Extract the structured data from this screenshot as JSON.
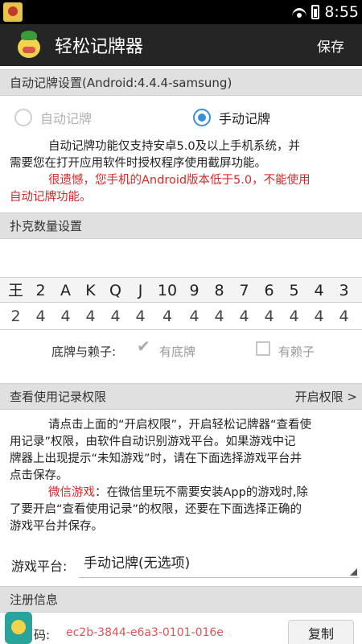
{
  "status_bar": {
    "time": "8:55"
  },
  "action_bar": {
    "title": "轻松记牌器",
    "save_label": "保存"
  },
  "auto_section": {
    "header": "自动记牌设置(Android:4.4.4-samsung)",
    "radio_auto": "自动记牌",
    "radio_manual": "手动记牌",
    "selected": "手动记牌",
    "info_line1": "自动记牌功能仅支持安卓5.0及以上手机系统，并",
    "info_line2": "需要您在打开应用软件时授权程序使用截屏功能。",
    "warning_line1": "很遗憾，您手机的Android版本低于5.0，不能使用",
    "warning_line2": "自动记牌功能。"
  },
  "poker_section": {
    "header": "扑克数量设置",
    "cards": [
      "王",
      "2",
      "A",
      "K",
      "Q",
      "J",
      "10",
      "9",
      "8",
      "7",
      "6",
      "5",
      "4",
      "3"
    ],
    "counts": [
      "2",
      "4",
      "4",
      "4",
      "4",
      "4",
      "4",
      "4",
      "4",
      "4",
      "4",
      "4",
      "4",
      "4"
    ],
    "bottom_label": "底牌与赖子:",
    "has_bottom": "有底牌",
    "has_wild": "有赖子",
    "has_bottom_checked": true,
    "has_wild_checked": false
  },
  "usage_section": {
    "header": "查看使用记录权限",
    "open_link": "开启权限 >",
    "para1_line1": "请点击上面的“开启权限”，开启轻松记牌器“查看使",
    "para1_line2": "用记录”权限，由软件自动识别游戏平台。如果游戏中记",
    "para1_line3": "牌器上出现提示“未知游戏”时，请在下面选择游戏平台并",
    "para1_line4": "点击保存。",
    "wechat_label": "微信游戏",
    "para2_line1_rest": "：在微信里玩不需要安装App的游戏时,除",
    "para2_line2": "了要开启“查看使用记录”的权限，还要在下面选择正确的",
    "para2_line3": "游戏平台并保存。",
    "platform_label": "游戏平台:",
    "platform_value": "手动记牌(无选项)"
  },
  "register_section": {
    "header": "注册信息",
    "code_label": "码:",
    "code_value": "ec2b-3844-e6a3-0101-016e",
    "copy_label": "复制"
  }
}
